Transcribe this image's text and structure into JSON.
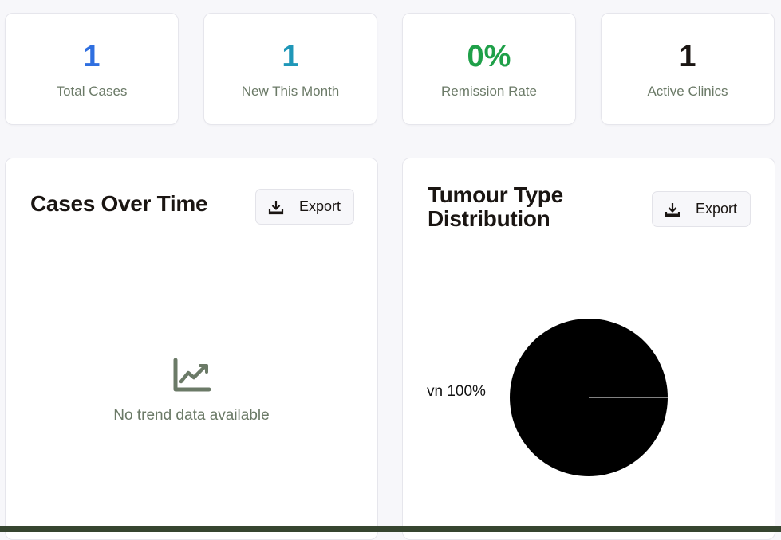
{
  "stats": [
    {
      "value": "1",
      "label": "Total Cases",
      "color": "#2f6fe0"
    },
    {
      "value": "1",
      "label": "New This Month",
      "color": "#1f97b8"
    },
    {
      "value": "0%",
      "label": "Remission Rate",
      "color": "#1fa049"
    },
    {
      "value": "1",
      "label": "Active Clinics",
      "color": "#1a1512"
    }
  ],
  "cases_panel": {
    "title": "Cases Over Time",
    "export_label": "Export",
    "export_icon": "download-icon",
    "empty_icon": "line-chart-icon",
    "empty_text": "No trend data available"
  },
  "tumour_panel": {
    "title_line1": "Tumour Type",
    "title_line2": "Distribution",
    "export_label": "Export",
    "export_icon": "download-icon",
    "slice_label": "vn 100%"
  },
  "chart_data": {
    "type": "pie",
    "title": "Tumour Type Distribution",
    "values": [
      100
    ],
    "labels": [
      "vn 100%"
    ],
    "colors": [
      "#000000"
    ]
  },
  "colors": {
    "background": "#f7f7fa",
    "muted_text": "#6b7a67",
    "bottom_bar": "#36452f"
  }
}
